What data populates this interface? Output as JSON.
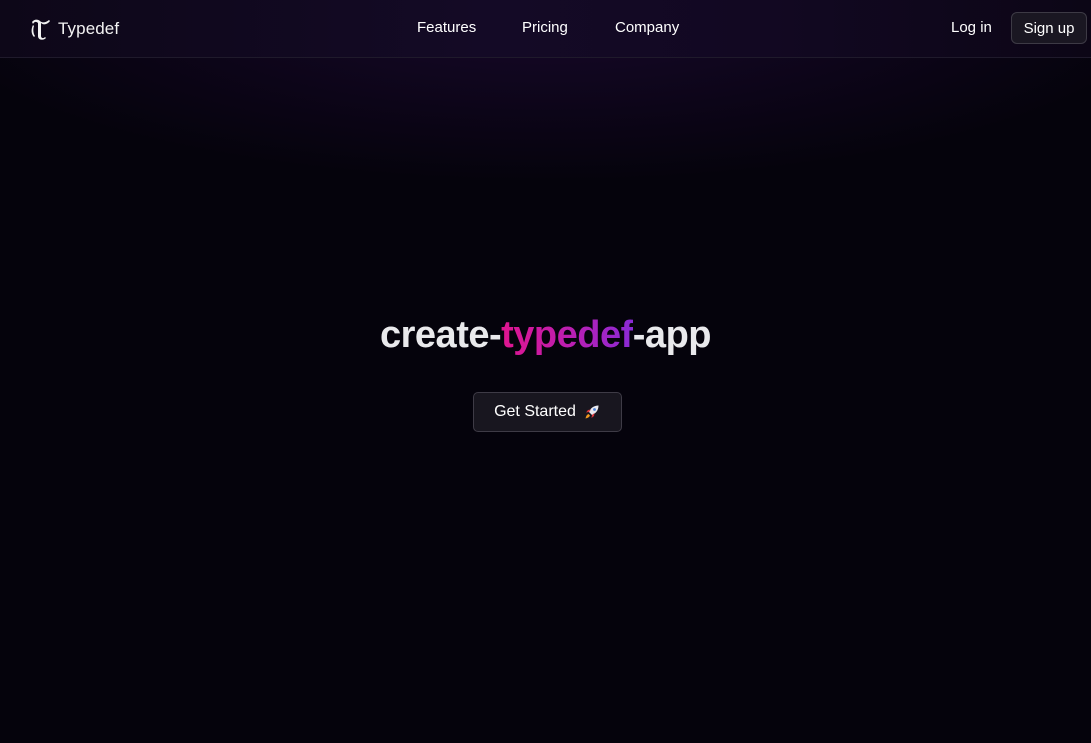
{
  "header": {
    "brand": {
      "name": "Typedef",
      "logo_icon": "blackletter-t-logo-icon"
    },
    "nav": [
      {
        "label": "Features"
      },
      {
        "label": "Pricing"
      },
      {
        "label": "Company"
      }
    ],
    "login_label": "Log in",
    "signup_label": "Sign up"
  },
  "hero": {
    "title_prefix": "create-",
    "title_highlight": "typedef",
    "title_suffix": "-app",
    "cta_label": "Get Started",
    "cta_icon": "rocket-icon"
  },
  "colors": {
    "background": "#05030c",
    "navbar": "#120822",
    "highlight_start": "#e0158f",
    "highlight_end": "#8a2ad6",
    "button_bg": "#18161f",
    "button_border": "#3e3b46"
  }
}
